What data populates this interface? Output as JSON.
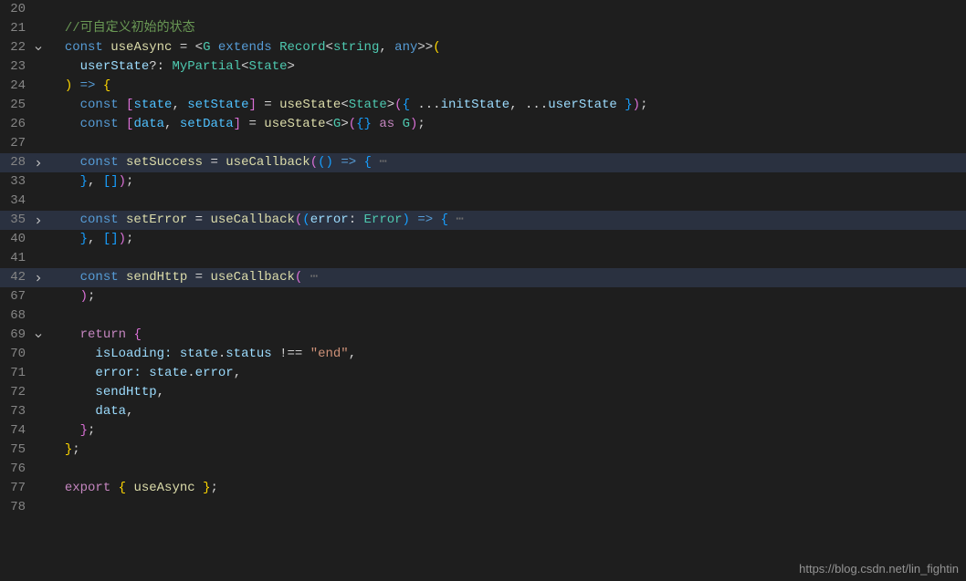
{
  "watermark": "https://blog.csdn.net/lin_fightin",
  "lines": [
    {
      "num": "20",
      "fold": "",
      "hl": false,
      "tokens": []
    },
    {
      "num": "21",
      "fold": "",
      "hl": false,
      "tokens": [
        {
          "t": "  ",
          "c": ""
        },
        {
          "t": "//可自定义初始的状态",
          "c": "tk-comment"
        }
      ]
    },
    {
      "num": "22",
      "fold": "down",
      "hl": false,
      "tokens": [
        {
          "t": "  ",
          "c": ""
        },
        {
          "t": "const",
          "c": "tk-storage"
        },
        {
          "t": " ",
          "c": ""
        },
        {
          "t": "useAsync",
          "c": "tk-func"
        },
        {
          "t": " = ",
          "c": "tk-punct"
        },
        {
          "t": "<",
          "c": "tk-punct"
        },
        {
          "t": "G",
          "c": "tk-type"
        },
        {
          "t": " ",
          "c": ""
        },
        {
          "t": "extends",
          "c": "tk-storage"
        },
        {
          "t": " ",
          "c": ""
        },
        {
          "t": "Record",
          "c": "tk-type"
        },
        {
          "t": "<",
          "c": "tk-punct"
        },
        {
          "t": "string",
          "c": "tk-type"
        },
        {
          "t": ", ",
          "c": "tk-punct"
        },
        {
          "t": "any",
          "c": "tk-storage"
        },
        {
          "t": ">>",
          "c": "tk-punct"
        },
        {
          "t": "(",
          "c": "tk-brace-y"
        }
      ]
    },
    {
      "num": "23",
      "fold": "",
      "hl": false,
      "tokens": [
        {
          "t": "    ",
          "c": ""
        },
        {
          "t": "userState",
          "c": "tk-var"
        },
        {
          "t": "?: ",
          "c": "tk-punct"
        },
        {
          "t": "MyPartial",
          "c": "tk-type"
        },
        {
          "t": "<",
          "c": "tk-punct"
        },
        {
          "t": "State",
          "c": "tk-type"
        },
        {
          "t": ">",
          "c": "tk-punct"
        }
      ]
    },
    {
      "num": "24",
      "fold": "",
      "hl": false,
      "tokens": [
        {
          "t": "  ",
          "c": ""
        },
        {
          "t": ")",
          "c": "tk-brace-y"
        },
        {
          "t": " ",
          "c": ""
        },
        {
          "t": "=>",
          "c": "tk-storage"
        },
        {
          "t": " ",
          "c": ""
        },
        {
          "t": "{",
          "c": "tk-brace-y"
        }
      ]
    },
    {
      "num": "25",
      "fold": "",
      "hl": false,
      "tokens": [
        {
          "t": "    ",
          "c": ""
        },
        {
          "t": "const",
          "c": "tk-storage"
        },
        {
          "t": " ",
          "c": ""
        },
        {
          "t": "[",
          "c": "tk-brace-p"
        },
        {
          "t": "state",
          "c": "tk-const"
        },
        {
          "t": ", ",
          "c": "tk-punct"
        },
        {
          "t": "setState",
          "c": "tk-const"
        },
        {
          "t": "]",
          "c": "tk-brace-p"
        },
        {
          "t": " = ",
          "c": "tk-punct"
        },
        {
          "t": "useState",
          "c": "tk-func"
        },
        {
          "t": "<",
          "c": "tk-punct"
        },
        {
          "t": "State",
          "c": "tk-type"
        },
        {
          "t": ">",
          "c": "tk-punct"
        },
        {
          "t": "(",
          "c": "tk-brace-p"
        },
        {
          "t": "{",
          "c": "tk-brace-b"
        },
        {
          "t": " ...",
          "c": "tk-punct"
        },
        {
          "t": "initState",
          "c": "tk-var"
        },
        {
          "t": ", ...",
          "c": "tk-punct"
        },
        {
          "t": "userState",
          "c": "tk-var"
        },
        {
          "t": " ",
          "c": ""
        },
        {
          "t": "}",
          "c": "tk-brace-b"
        },
        {
          "t": ")",
          "c": "tk-brace-p"
        },
        {
          "t": ";",
          "c": "tk-punct"
        }
      ]
    },
    {
      "num": "26",
      "fold": "",
      "hl": false,
      "tokens": [
        {
          "t": "    ",
          "c": ""
        },
        {
          "t": "const",
          "c": "tk-storage"
        },
        {
          "t": " ",
          "c": ""
        },
        {
          "t": "[",
          "c": "tk-brace-p"
        },
        {
          "t": "data",
          "c": "tk-const"
        },
        {
          "t": ", ",
          "c": "tk-punct"
        },
        {
          "t": "setData",
          "c": "tk-const"
        },
        {
          "t": "]",
          "c": "tk-brace-p"
        },
        {
          "t": " = ",
          "c": "tk-punct"
        },
        {
          "t": "useState",
          "c": "tk-func"
        },
        {
          "t": "<",
          "c": "tk-punct"
        },
        {
          "t": "G",
          "c": "tk-type"
        },
        {
          "t": ">",
          "c": "tk-punct"
        },
        {
          "t": "(",
          "c": "tk-brace-p"
        },
        {
          "t": "{}",
          "c": "tk-brace-b"
        },
        {
          "t": " ",
          "c": ""
        },
        {
          "t": "as",
          "c": "tk-keyword"
        },
        {
          "t": " ",
          "c": ""
        },
        {
          "t": "G",
          "c": "tk-type"
        },
        {
          "t": ")",
          "c": "tk-brace-p"
        },
        {
          "t": ";",
          "c": "tk-punct"
        }
      ]
    },
    {
      "num": "27",
      "fold": "",
      "hl": false,
      "tokens": []
    },
    {
      "num": "28",
      "fold": "right",
      "hl": true,
      "tokens": [
        {
          "t": "    ",
          "c": ""
        },
        {
          "t": "const",
          "c": "tk-storage"
        },
        {
          "t": " ",
          "c": ""
        },
        {
          "t": "setSuccess",
          "c": "tk-func"
        },
        {
          "t": " = ",
          "c": "tk-punct"
        },
        {
          "t": "useCallback",
          "c": "tk-func"
        },
        {
          "t": "(",
          "c": "tk-brace-p"
        },
        {
          "t": "()",
          "c": "tk-brace-b"
        },
        {
          "t": " ",
          "c": ""
        },
        {
          "t": "=>",
          "c": "tk-storage"
        },
        {
          "t": " ",
          "c": ""
        },
        {
          "t": "{",
          "c": "tk-brace-b"
        },
        {
          "t": " ⋯",
          "c": "tk-dots"
        }
      ]
    },
    {
      "num": "33",
      "fold": "",
      "hl": false,
      "tokens": [
        {
          "t": "    ",
          "c": ""
        },
        {
          "t": "}",
          "c": "tk-brace-b"
        },
        {
          "t": ", ",
          "c": "tk-punct"
        },
        {
          "t": "[]",
          "c": "tk-brace-b"
        },
        {
          "t": ")",
          "c": "tk-brace-p"
        },
        {
          "t": ";",
          "c": "tk-punct"
        }
      ]
    },
    {
      "num": "34",
      "fold": "",
      "hl": false,
      "tokens": []
    },
    {
      "num": "35",
      "fold": "right",
      "hl": true,
      "tokens": [
        {
          "t": "    ",
          "c": ""
        },
        {
          "t": "const",
          "c": "tk-storage"
        },
        {
          "t": " ",
          "c": ""
        },
        {
          "t": "setError",
          "c": "tk-func"
        },
        {
          "t": " = ",
          "c": "tk-punct"
        },
        {
          "t": "useCallback",
          "c": "tk-func"
        },
        {
          "t": "(",
          "c": "tk-brace-p"
        },
        {
          "t": "(",
          "c": "tk-brace-b"
        },
        {
          "t": "error",
          "c": "tk-var"
        },
        {
          "t": ": ",
          "c": "tk-punct"
        },
        {
          "t": "Error",
          "c": "tk-type"
        },
        {
          "t": ")",
          "c": "tk-brace-b"
        },
        {
          "t": " ",
          "c": ""
        },
        {
          "t": "=>",
          "c": "tk-storage"
        },
        {
          "t": " ",
          "c": ""
        },
        {
          "t": "{",
          "c": "tk-brace-b"
        },
        {
          "t": " ⋯",
          "c": "tk-dots"
        }
      ]
    },
    {
      "num": "40",
      "fold": "",
      "hl": false,
      "tokens": [
        {
          "t": "    ",
          "c": ""
        },
        {
          "t": "}",
          "c": "tk-brace-b"
        },
        {
          "t": ", ",
          "c": "tk-punct"
        },
        {
          "t": "[]",
          "c": "tk-brace-b"
        },
        {
          "t": ")",
          "c": "tk-brace-p"
        },
        {
          "t": ";",
          "c": "tk-punct"
        }
      ]
    },
    {
      "num": "41",
      "fold": "",
      "hl": false,
      "tokens": []
    },
    {
      "num": "42",
      "fold": "right",
      "hl": true,
      "tokens": [
        {
          "t": "    ",
          "c": ""
        },
        {
          "t": "const",
          "c": "tk-storage"
        },
        {
          "t": " ",
          "c": ""
        },
        {
          "t": "sendHttp",
          "c": "tk-func"
        },
        {
          "t": " = ",
          "c": "tk-punct"
        },
        {
          "t": "useCallback",
          "c": "tk-func"
        },
        {
          "t": "(",
          "c": "tk-brace-p"
        },
        {
          "t": " ⋯",
          "c": "tk-dots"
        }
      ]
    },
    {
      "num": "67",
      "fold": "",
      "hl": false,
      "tokens": [
        {
          "t": "    ",
          "c": ""
        },
        {
          "t": ")",
          "c": "tk-brace-p"
        },
        {
          "t": ";",
          "c": "tk-punct"
        }
      ]
    },
    {
      "num": "68",
      "fold": "",
      "hl": false,
      "tokens": []
    },
    {
      "num": "69",
      "fold": "down",
      "hl": false,
      "tokens": [
        {
          "t": "    ",
          "c": ""
        },
        {
          "t": "return",
          "c": "tk-keyword"
        },
        {
          "t": " ",
          "c": ""
        },
        {
          "t": "{",
          "c": "tk-brace-p"
        }
      ]
    },
    {
      "num": "70",
      "fold": "",
      "hl": false,
      "tokens": [
        {
          "t": "      ",
          "c": ""
        },
        {
          "t": "isLoading:",
          "c": "tk-var"
        },
        {
          "t": " ",
          "c": ""
        },
        {
          "t": "state",
          "c": "tk-var"
        },
        {
          "t": ".",
          "c": "tk-punct"
        },
        {
          "t": "status",
          "c": "tk-var"
        },
        {
          "t": " !== ",
          "c": "tk-punct"
        },
        {
          "t": "\"end\"",
          "c": "tk-string"
        },
        {
          "t": ",",
          "c": "tk-punct"
        }
      ]
    },
    {
      "num": "71",
      "fold": "",
      "hl": false,
      "tokens": [
        {
          "t": "      ",
          "c": ""
        },
        {
          "t": "error:",
          "c": "tk-var"
        },
        {
          "t": " ",
          "c": ""
        },
        {
          "t": "state",
          "c": "tk-var"
        },
        {
          "t": ".",
          "c": "tk-punct"
        },
        {
          "t": "error",
          "c": "tk-var"
        },
        {
          "t": ",",
          "c": "tk-punct"
        }
      ]
    },
    {
      "num": "72",
      "fold": "",
      "hl": false,
      "tokens": [
        {
          "t": "      ",
          "c": ""
        },
        {
          "t": "sendHttp",
          "c": "tk-var"
        },
        {
          "t": ",",
          "c": "tk-punct"
        }
      ]
    },
    {
      "num": "73",
      "fold": "",
      "hl": false,
      "tokens": [
        {
          "t": "      ",
          "c": ""
        },
        {
          "t": "data",
          "c": "tk-var"
        },
        {
          "t": ",",
          "c": "tk-punct"
        }
      ]
    },
    {
      "num": "74",
      "fold": "",
      "hl": false,
      "tokens": [
        {
          "t": "    ",
          "c": ""
        },
        {
          "t": "}",
          "c": "tk-brace-p"
        },
        {
          "t": ";",
          "c": "tk-punct"
        }
      ]
    },
    {
      "num": "75",
      "fold": "",
      "hl": false,
      "tokens": [
        {
          "t": "  ",
          "c": ""
        },
        {
          "t": "}",
          "c": "tk-brace-y"
        },
        {
          "t": ";",
          "c": "tk-punct"
        }
      ]
    },
    {
      "num": "76",
      "fold": "",
      "hl": false,
      "tokens": []
    },
    {
      "num": "77",
      "fold": "",
      "hl": false,
      "tokens": [
        {
          "t": "  ",
          "c": ""
        },
        {
          "t": "export",
          "c": "tk-keyword"
        },
        {
          "t": " ",
          "c": ""
        },
        {
          "t": "{",
          "c": "tk-brace-y"
        },
        {
          "t": " ",
          "c": ""
        },
        {
          "t": "useAsync",
          "c": "tk-func"
        },
        {
          "t": " ",
          "c": ""
        },
        {
          "t": "}",
          "c": "tk-brace-y"
        },
        {
          "t": ";",
          "c": "tk-punct"
        }
      ]
    },
    {
      "num": "78",
      "fold": "",
      "hl": false,
      "tokens": []
    }
  ]
}
